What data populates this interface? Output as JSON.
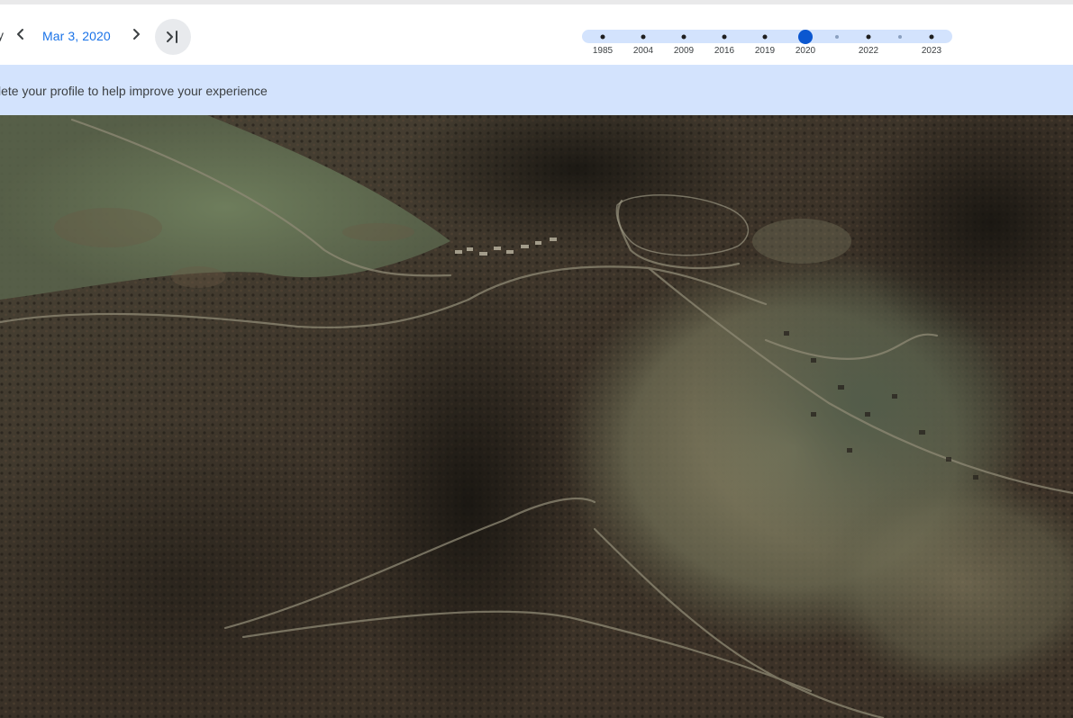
{
  "toolbar": {
    "truncated_text": "y",
    "date": "Mar 3, 2020",
    "prev_icon": "chevron-left-icon",
    "next_icon": "chevron-right-icon",
    "latest_icon": "skip-to-latest-icon"
  },
  "timeline": {
    "active_year": "2020",
    "labels": [
      "1985",
      "2004",
      "2009",
      "2016",
      "2019",
      "2020",
      "2022",
      "2023"
    ]
  },
  "banner": {
    "text": "lete your profile to help improve your experience"
  },
  "colors": {
    "accent": "#1a73e8",
    "active_dot": "#0b57d0",
    "timeline_track": "#d3e3fd",
    "banner_bg": "#d3e3fd"
  }
}
